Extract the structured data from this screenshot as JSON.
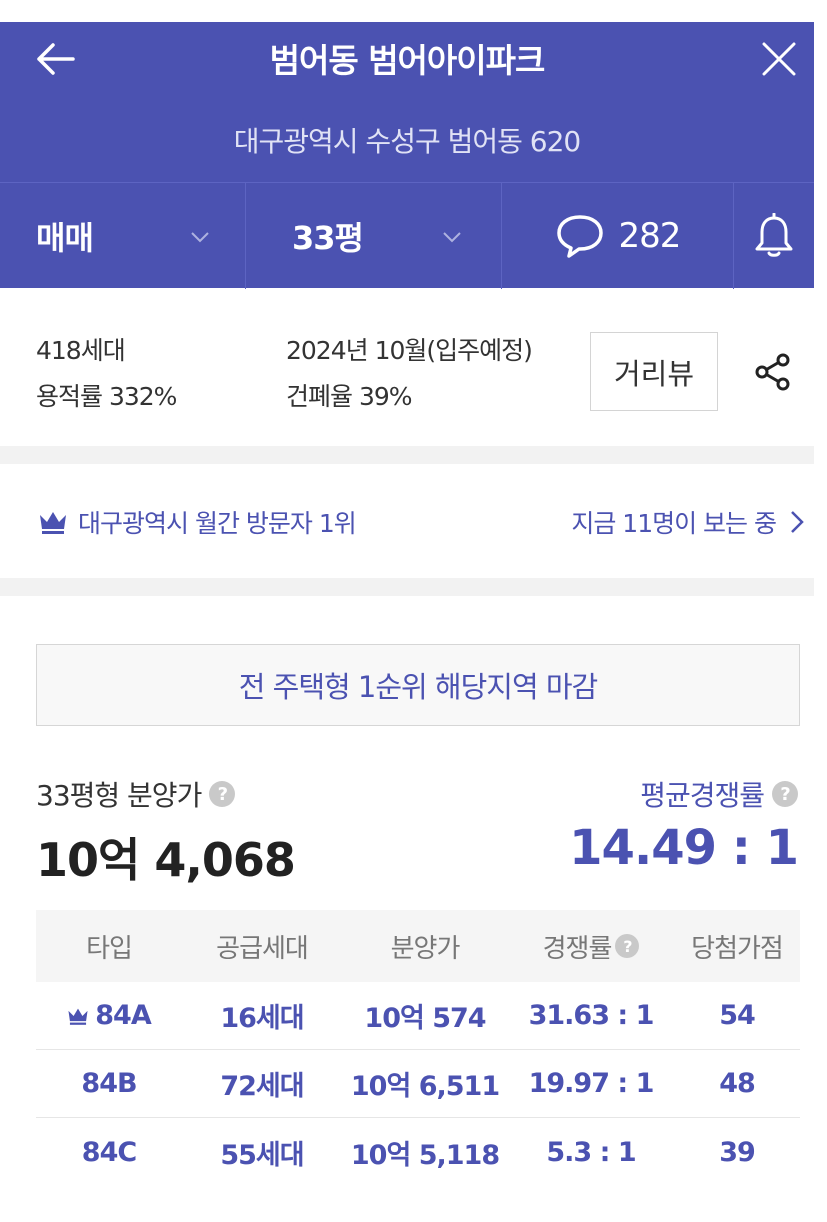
{
  "header": {
    "title": "범어동 범어아이파크",
    "address": "대구광역시 수성구 범어동 620",
    "tabs": {
      "deal_type": "매매",
      "size": "33평",
      "comment_count": "282"
    }
  },
  "info": {
    "households": "418세대",
    "floor_area_ratio": "용적률 332%",
    "move_in": "2024년 10월(입주예정)",
    "building_coverage": "건폐율 39%",
    "street_view_label": "거리뷰"
  },
  "rank": {
    "text": "대구광역시 월간 방문자 1위",
    "viewers": "지금 11명이 보는 중"
  },
  "notice": "전 주택형 1순위 해당지역 마감",
  "summary": {
    "price_label": "33평형 분양가",
    "price_value": "10억 4,068",
    "competition_label": "평균경쟁률",
    "competition_value": "14.49 : 1"
  },
  "table": {
    "headers": [
      "타입",
      "공급세대",
      "분양가",
      "경쟁률",
      "당첨가점"
    ],
    "rows": [
      {
        "type": "84A",
        "supply": "16세대",
        "price": "10억 574",
        "ratio": "31.63 : 1",
        "score": "54"
      },
      {
        "type": "84B",
        "supply": "72세대",
        "price": "10억 6,511",
        "ratio": "19.97 : 1",
        "score": "48"
      },
      {
        "type": "84C",
        "supply": "55세대",
        "price": "10억 5,118",
        "ratio": "5.3 : 1",
        "score": "39"
      }
    ]
  },
  "colors": {
    "brand": "#4b52b1",
    "separator": "#f2f2f2"
  }
}
